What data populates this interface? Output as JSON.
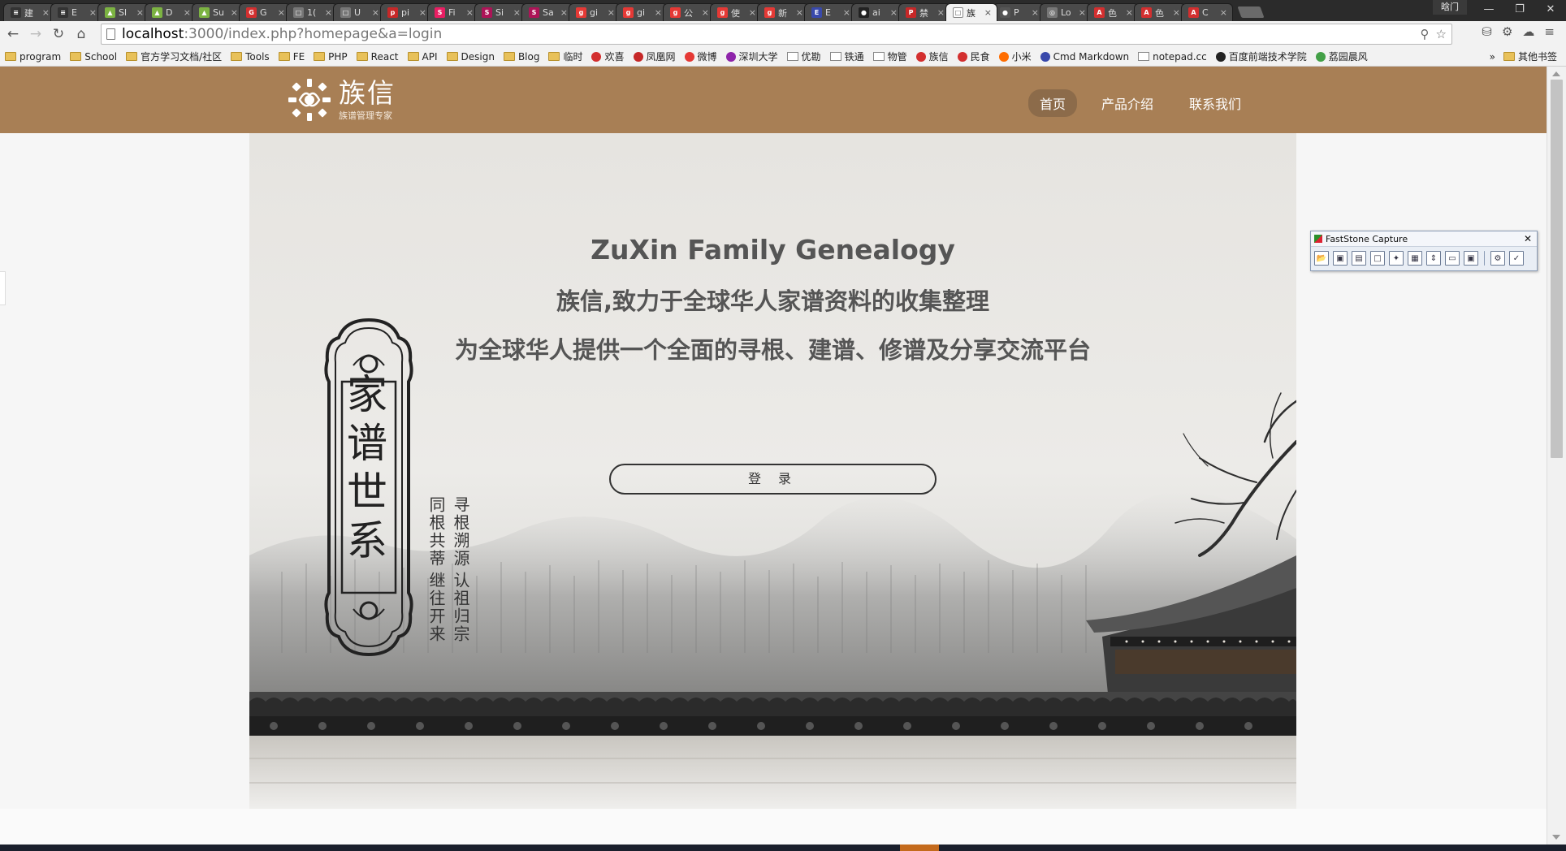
{
  "browser": {
    "tabs": [
      {
        "title": "建",
        "color": "#333333",
        "glyph": "≡"
      },
      {
        "title": "E",
        "color": "#333333",
        "glyph": "≡"
      },
      {
        "title": "Sl",
        "color": "#7cb342",
        "glyph": "▲"
      },
      {
        "title": "D",
        "color": "#7cb342",
        "glyph": "▲"
      },
      {
        "title": "Su",
        "color": "#7cb342",
        "glyph": "▲"
      },
      {
        "title": "G",
        "color": "#d32f2f",
        "glyph": "G"
      },
      {
        "title": "1(",
        "color": "#777777",
        "glyph": "□"
      },
      {
        "title": "U",
        "color": "#777777",
        "glyph": "□"
      },
      {
        "title": "pi",
        "color": "#c62828",
        "glyph": "p"
      },
      {
        "title": "Fi",
        "color": "#e91e63",
        "glyph": "S"
      },
      {
        "title": "Si",
        "color": "#ad1457",
        "glyph": "S"
      },
      {
        "title": "Sa",
        "color": "#ad1457",
        "glyph": "S"
      },
      {
        "title": "gi",
        "color": "#e53935",
        "glyph": "g"
      },
      {
        "title": "gi",
        "color": "#e53935",
        "glyph": "g"
      },
      {
        "title": "公",
        "color": "#e53935",
        "glyph": "g"
      },
      {
        "title": "使",
        "color": "#e53935",
        "glyph": "g"
      },
      {
        "title": "新",
        "color": "#e53935",
        "glyph": "g"
      },
      {
        "title": "E",
        "color": "#3949ab",
        "glyph": "E"
      },
      {
        "title": "ai",
        "color": "#222222",
        "glyph": "●"
      },
      {
        "title": "禁",
        "color": "#c62828",
        "glyph": "P"
      },
      {
        "title": "族",
        "color": "#ffffff",
        "glyph": "□",
        "active": true
      },
      {
        "title": "P",
        "color": "#555555",
        "glyph": "●"
      },
      {
        "title": "Lo",
        "color": "#777777",
        "glyph": "◎"
      },
      {
        "title": "色",
        "color": "#d32f2f",
        "glyph": "A"
      },
      {
        "title": "色",
        "color": "#d32f2f",
        "glyph": "A"
      },
      {
        "title": "C",
        "color": "#d32f2f",
        "glyph": "A"
      }
    ],
    "user_label": "晗门",
    "window_buttons": [
      "—",
      "❐",
      "✕"
    ],
    "url_host": "localhost",
    "url_path": ":3000/index.php?homepage&a=login",
    "bookmarks": [
      "program",
      "School",
      "官方学习文档/社区",
      "Tools",
      "FE",
      "PHP",
      "React",
      "API",
      "Design",
      "Blog",
      "临时",
      "欢喜",
      "凤凰网",
      "微博",
      "深圳大学",
      "优勘",
      "铁通",
      "物管",
      "族信",
      "民食",
      "小米",
      "Cmd Markdown",
      "notepad.cc",
      "百度前端技术学院",
      "荔园晨风"
    ],
    "bookmarks_more": "»",
    "bookmarks_other": "其他书签"
  },
  "site": {
    "logo_name": "族信",
    "logo_sub": "族谱管理专家",
    "nav": [
      {
        "label": "首页",
        "active": true
      },
      {
        "label": "产品介绍",
        "active": false
      },
      {
        "label": "联系我们",
        "active": false
      }
    ],
    "brand_color": "#a87f55"
  },
  "hero": {
    "title": "ZuXin Family Genealogy",
    "subtitle1": "族信,致力于全球华人家谱资料的收集整理",
    "subtitle2": "为全球华人提供一个全面的寻根、建谱、修谱及分享交流平台",
    "login_label": "登 录",
    "seal_chars": [
      "家",
      "谱",
      "世",
      "系"
    ],
    "poem_left_top": "同根共蒂",
    "poem_left_bottom": "继往开来",
    "poem_right_top": "寻根溯源",
    "poem_right_bottom": "认祖归宗"
  },
  "faststone": {
    "title": "FastStone Capture",
    "close": "✕"
  }
}
